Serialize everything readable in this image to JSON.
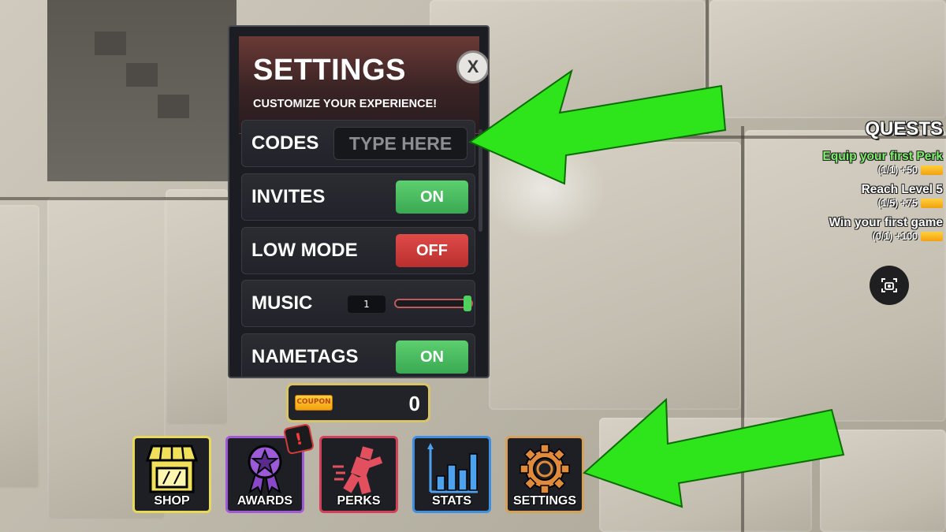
{
  "settings_panel": {
    "title": "SETTINGS",
    "subtitle": "CUSTOMIZE YOUR EXPERIENCE!",
    "close_label": "X",
    "rows": {
      "codes": {
        "label": "CODES",
        "placeholder": "TYPE HERE"
      },
      "invites": {
        "label": "INVITES",
        "state": "ON"
      },
      "low_mode": {
        "label": "LOW MODE",
        "state": "OFF"
      },
      "music": {
        "label": "MUSIC",
        "value": "1",
        "slider_level": 1.0
      },
      "nametags": {
        "label": "NAMETAGS",
        "state": "ON"
      }
    }
  },
  "coupon_counter": {
    "ticket_text": "COUPON",
    "count": "0"
  },
  "bottom_menu": {
    "shop": "SHOP",
    "awards": "AWARDS",
    "awards_alert": "!",
    "perks": "PERKS",
    "stats": "STATS",
    "settings": "SETTINGS"
  },
  "quests": {
    "title": "QUESTS",
    "items": [
      {
        "name": "Equip your first Perk",
        "progress": "(1/1) +50",
        "completed": true
      },
      {
        "name": "Reach Level 5",
        "progress": "(1/5) +75",
        "completed": false
      },
      {
        "name": "Win your first game",
        "progress": "(0/1) +100",
        "completed": false
      }
    ]
  },
  "colors": {
    "toggle_on": "#3aa953",
    "toggle_off": "#b8302f",
    "quest_complete": "#7cf06a",
    "annotation_arrow": "#2ee51b"
  },
  "icons": {
    "close": "close-icon",
    "shop": "storefront-icon",
    "awards": "ribbon-star-icon",
    "perks": "running-figure-icon",
    "stats": "bar-chart-icon",
    "settings": "gear-icon",
    "coupon": "coupon-ticket-icon",
    "screenshot": "camera-icon"
  }
}
